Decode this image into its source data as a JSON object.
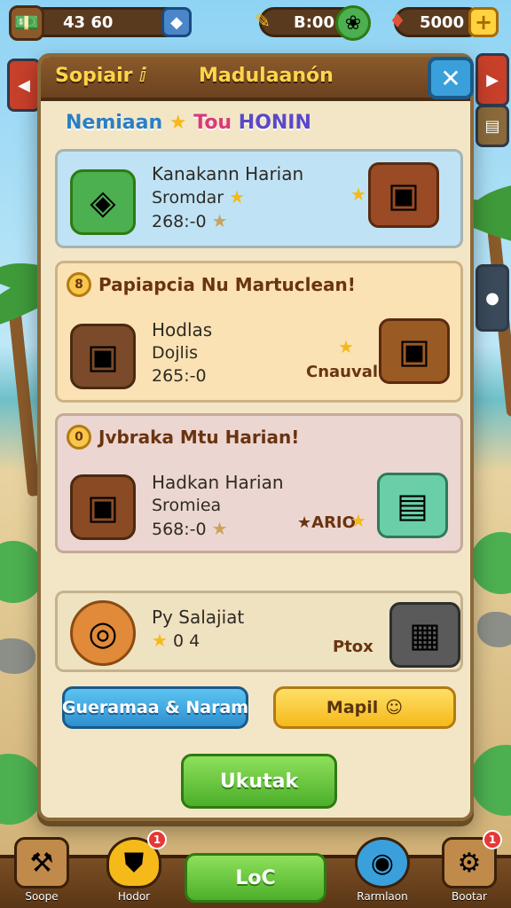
{
  "hud": {
    "resource1_value": "43 60",
    "resource2_value": "B:00",
    "resource3_value": "5000",
    "plus_label": "+"
  },
  "modal": {
    "title_left": "Sopiair ⅈ",
    "title_main": "Madulaanón",
    "close_label": "✕",
    "subtitle_part1": "Nemiaan",
    "subtitle_part2": "Tou",
    "subtitle_part3": "HONIN"
  },
  "cards": [
    {
      "heading": "",
      "badge": "",
      "title": "Kanakann Harian",
      "line2": "Sromdar",
      "line3": "268:-0",
      "reward_label": ""
    },
    {
      "heading": "Papiapcia Nu Martuclean!",
      "badge": "8",
      "title": "Hodlas",
      "line2": "Dojlis",
      "line3": "265:-0",
      "reward_label": "Cnauval"
    },
    {
      "heading": "Jvbraka Mtu Harian!",
      "badge": "0",
      "title": "Hadkan Harian",
      "line2": "Sromiea",
      "line3": "568:-0",
      "reward_label": "★ARIO"
    },
    {
      "heading": "",
      "badge": "",
      "title": "Py Salajiat",
      "line2": "",
      "line3": "0 4",
      "reward_label": "Ptox"
    }
  ],
  "buttons": {
    "blue_label": "Gueramaa & Naram",
    "yellow_label": "Mapil",
    "green_label": "Ukutak"
  },
  "nav": {
    "items": [
      {
        "label": "Soope",
        "badge": ""
      },
      {
        "label": "Hodor",
        "badge": "1"
      },
      {
        "label": "LoC",
        "badge": ""
      },
      {
        "label": "Rarmlaon",
        "badge": ""
      },
      {
        "label": "Bootar",
        "badge": "1"
      }
    ]
  },
  "colors": {
    "modal_bg": "#f3e6c6",
    "card_blue": "#bfe3f5",
    "card_orange": "#fbe2b4",
    "card_pink": "#ecd6d2",
    "card_beige": "#efe2c0",
    "accent_green": "#4caf2a",
    "accent_yellow": "#f5b91a",
    "accent_blue": "#2e8fd0"
  }
}
